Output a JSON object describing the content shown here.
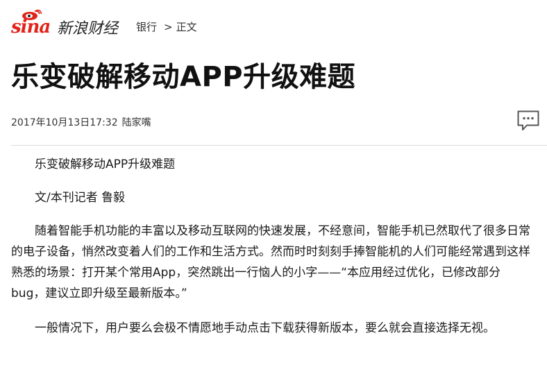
{
  "brand": {
    "logo_en": "sina",
    "logo_cn": "新浪财经"
  },
  "breadcrumb": {
    "section": "银行",
    "separator": ">",
    "current": "正文"
  },
  "article": {
    "title": "乐变破解移动APP升级难题",
    "date": "2017年10月13日17:32",
    "author": "陆家嘴",
    "paragraphs": [
      "乐变破解移动APP升级难题",
      "文/本刊记者 鲁毅",
      "随着智能手机功能的丰富以及移动互联网的快速发展，不经意间，智能手机已然取代了很多日常的电子设备，悄然改变着人们的工作和生活方式。然而时时刻刻手捧智能机的人们可能经常遇到这样熟悉的场景：打开某个常用App，突然跳出一行恼人的小字——“本应用经过优化，已修改部分bug，建议立即升级至最新版本。”",
      "一般情况下，用户要么会极不情愿地手动点击下载获得新版本，要么就会直接选择无视。"
    ]
  },
  "icons": {
    "comment": "comment-bubble-icon",
    "logo_eye": "sina-eye-icon"
  },
  "colors": {
    "brand_red": "#e2231a",
    "divider": "#dcdcdc",
    "text": "#1a1a1a"
  }
}
